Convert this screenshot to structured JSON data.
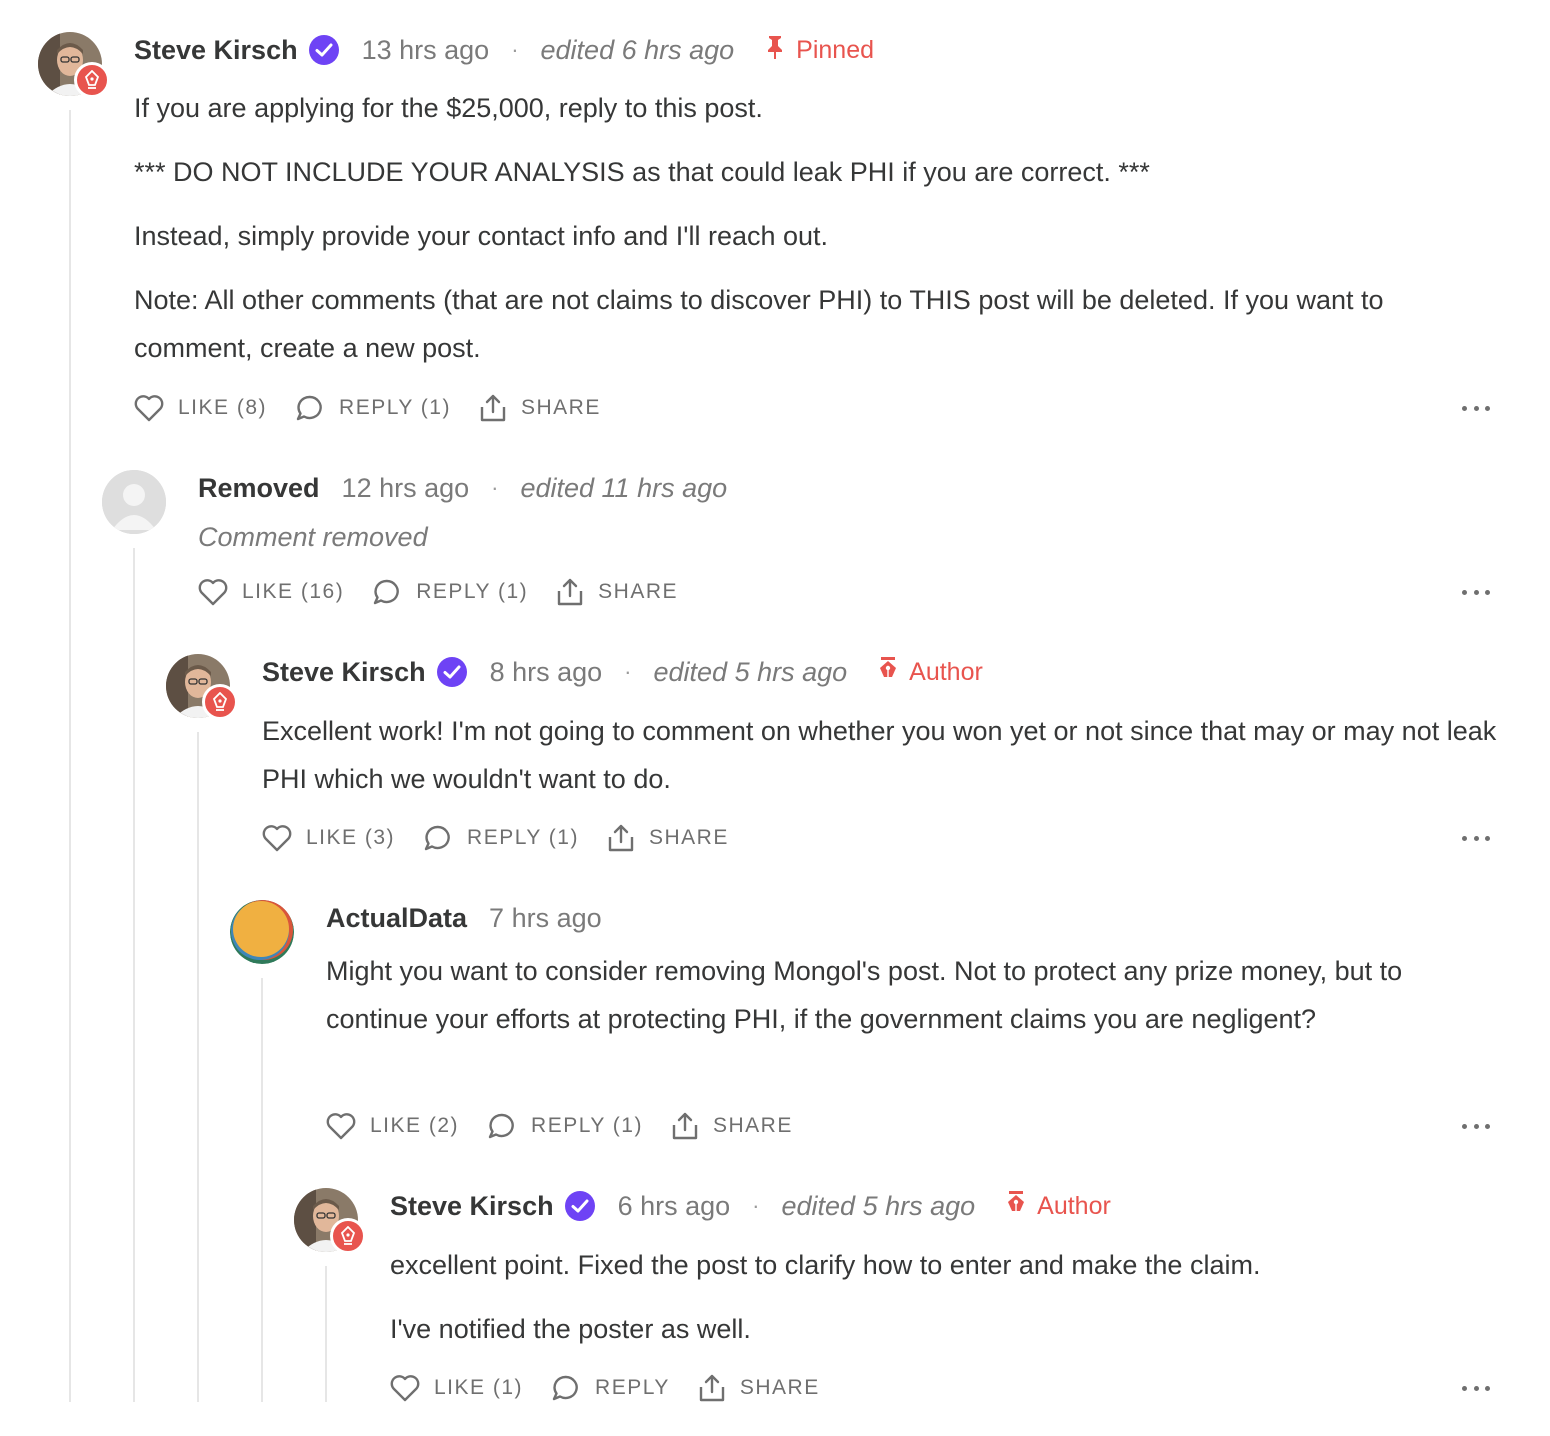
{
  "colors": {
    "accent": "#e8544e",
    "verified": "#6e43f5",
    "text": "#363737",
    "muted": "#7a7a7a",
    "line": "#e6e6e6"
  },
  "comments": [
    {
      "author": "Steve Kirsch",
      "verified": true,
      "time": "13 hrs ago",
      "separator": "·",
      "edited": "edited 6 hrs ago",
      "tag": "Pinned",
      "tag_icon": "pin-icon",
      "paragraphs": [
        "If you are applying for the $25,000, reply to this post.",
        "*** DO NOT INCLUDE YOUR ANALYSIS as that could leak PHI if you are correct. ***",
        "Instead, simply provide your contact info and I'll reach out.",
        "Note: All other comments (that are not claims to discover PHI) to THIS post will be deleted. If you want to comment, create a new post."
      ],
      "like": "LIKE (8)",
      "reply": "REPLY (1)",
      "share": "SHARE"
    },
    {
      "author": "Removed",
      "time": "12 hrs ago",
      "separator": "·",
      "edited": "edited 11 hrs ago",
      "paragraphs": [
        "Comment removed"
      ],
      "like": "LIKE (16)",
      "reply": "REPLY (1)",
      "share": "SHARE"
    },
    {
      "author": "Steve Kirsch",
      "verified": true,
      "time": "8 hrs ago",
      "separator": "·",
      "edited": "edited 5 hrs ago",
      "tag": "Author",
      "tag_icon": "pen-nib-icon",
      "paragraphs": [
        "Excellent work! I'm not going to comment on whether you won yet or not since that may or may not leak PHI which we wouldn't want to do."
      ],
      "like": "LIKE (3)",
      "reply": "REPLY (1)",
      "share": "SHARE"
    },
    {
      "author": "ActualData",
      "time": "7 hrs ago",
      "paragraphs": [
        "Might you want to consider removing Mongol's post. Not to protect any prize money, but to continue your efforts at protecting PHI, if the government claims you are negligent?"
      ],
      "like": "LIKE (2)",
      "reply": "REPLY (1)",
      "share": "SHARE"
    },
    {
      "author": "Steve Kirsch",
      "verified": true,
      "time": "6 hrs ago",
      "separator": "·",
      "edited": "edited 5 hrs ago",
      "tag": "Author",
      "tag_icon": "pen-nib-icon",
      "paragraphs": [
        "excellent point. Fixed the post to clarify how to enter and make the claim.",
        "I've notified the poster as well."
      ],
      "like": "LIKE (1)",
      "reply": "REPLY",
      "share": "SHARE"
    }
  ]
}
